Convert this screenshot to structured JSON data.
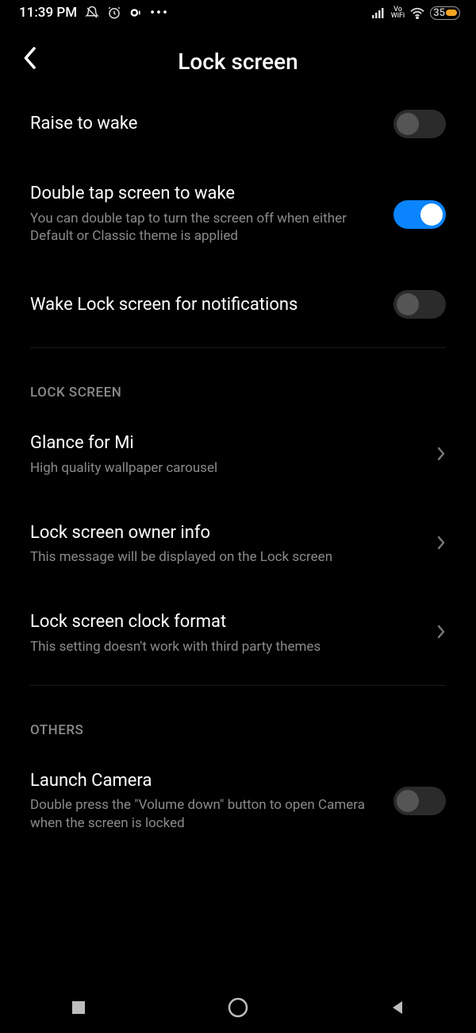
{
  "status": {
    "time": "11:39 PM",
    "battery": "35"
  },
  "header": {
    "title": "Lock screen"
  },
  "rows": {
    "raise": {
      "title": "Raise to wake"
    },
    "doubletap": {
      "title": "Double tap screen to wake",
      "sub": "You can double tap to turn the screen off when either Default or Classic theme is applied"
    },
    "wakelock": {
      "title": "Wake Lock screen for notifications"
    },
    "glance": {
      "title": "Glance for Mi",
      "sub": "High quality wallpaper carousel"
    },
    "owner": {
      "title": "Lock screen owner info",
      "sub": "This message will be displayed on the Lock screen"
    },
    "clock": {
      "title": "Lock screen clock format",
      "sub": "This setting doesn't work with third party themes"
    },
    "camera": {
      "title": "Launch Camera",
      "sub": "Double press the \"Volume down\" button to open Camera when the screen is locked"
    }
  },
  "sections": {
    "lockscreen": "LOCK SCREEN",
    "others": "OTHERS"
  }
}
